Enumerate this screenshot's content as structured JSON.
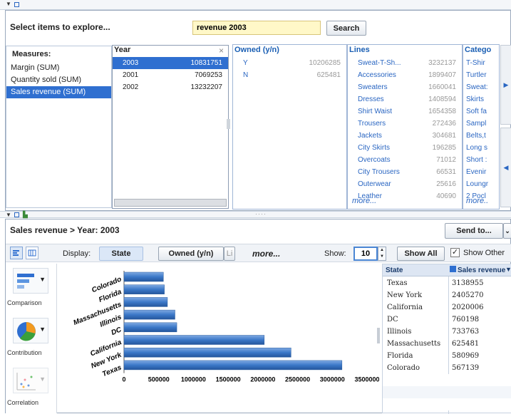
{
  "search": {
    "label": "Select items to explore...",
    "value": "revenue 2003",
    "button": "Search"
  },
  "measures": {
    "title": "Measures:",
    "items": [
      "Margin (SUM)",
      "Quantity sold (SUM)",
      "Sales revenue (SUM)"
    ],
    "selected_index": 2
  },
  "year": {
    "title": "Year",
    "close": "×",
    "rows": [
      {
        "k": "2003",
        "v": "10831751"
      },
      {
        "k": "2001",
        "v": "7069253"
      },
      {
        "k": "2002",
        "v": "13232207"
      }
    ],
    "selected_index": 0
  },
  "owned": {
    "title": "Owned (y/n)",
    "rows": [
      {
        "k": "Y",
        "v": "10206285"
      },
      {
        "k": "N",
        "v": "625481"
      }
    ]
  },
  "lines": {
    "title": "Lines",
    "rows": [
      {
        "k": "Sweat-T-Sh...",
        "v": "3232137"
      },
      {
        "k": "Accessories",
        "v": "1899407"
      },
      {
        "k": "Sweaters",
        "v": "1660041"
      },
      {
        "k": "Dresses",
        "v": "1408594"
      },
      {
        "k": "Shirt Waist",
        "v": "1654358"
      },
      {
        "k": "Trousers",
        "v": "272436"
      },
      {
        "k": "Jackets",
        "v": "304681"
      },
      {
        "k": "City Skirts",
        "v": "196285"
      },
      {
        "k": "Overcoats",
        "v": "71012"
      },
      {
        "k": "City Trousers",
        "v": "66531"
      },
      {
        "k": "Outerwear",
        "v": "25616"
      },
      {
        "k": "Leather",
        "v": "40690"
      }
    ],
    "more": "more..."
  },
  "category": {
    "title": "Catego",
    "rows": [
      "T-Shir",
      "Turtler",
      "Sweat:",
      "Skirts",
      "Soft fa",
      "Sampl",
      "Belts,t",
      "Long s",
      "Short :",
      "Evenir",
      "Loungr",
      "2 Pocl"
    ],
    "more": "more.."
  },
  "breadcrumb": "Sales revenue > Year: 2003",
  "send_to": "Send to...",
  "display": {
    "label": "Display:",
    "state": "State",
    "owned": "Owned (y/n)",
    "li": "Li",
    "more": "more...",
    "show_label": "Show:",
    "show_value": "10",
    "show_all": "Show All",
    "show_other": "Show Other"
  },
  "side": {
    "comparison": "Comparison",
    "contribution": "Contribution",
    "correlation": "Correlation"
  },
  "chart_data": {
    "type": "bar",
    "categories": [
      "Colorado",
      "Florida",
      "Massachusetts",
      "Illinois",
      "DC",
      "California",
      "New York",
      "Texas"
    ],
    "values": [
      567139,
      580969,
      625481,
      733763,
      760198,
      2020006,
      2405270,
      3138955
    ],
    "xlim": [
      0,
      3500000
    ],
    "xticks": [
      "0",
      "500000",
      "1000000",
      "1500000",
      "2000000",
      "2500000",
      "3000000",
      "3500000"
    ]
  },
  "table": {
    "headers": [
      "State",
      "Sales revenue"
    ],
    "rows": [
      {
        "state": "Texas",
        "rev": "3138955"
      },
      {
        "state": "New York",
        "rev": "2405270"
      },
      {
        "state": "California",
        "rev": "2020006"
      },
      {
        "state": "DC",
        "rev": "760198"
      },
      {
        "state": "Illinois",
        "rev": "733763"
      },
      {
        "state": "Massachusetts",
        "rev": "625481"
      },
      {
        "state": "Florida",
        "rev": "580969"
      },
      {
        "state": "Colorado",
        "rev": "567139"
      }
    ]
  },
  "colors": {
    "accent": "#2f6fd0",
    "bar": "#3b78c8"
  }
}
